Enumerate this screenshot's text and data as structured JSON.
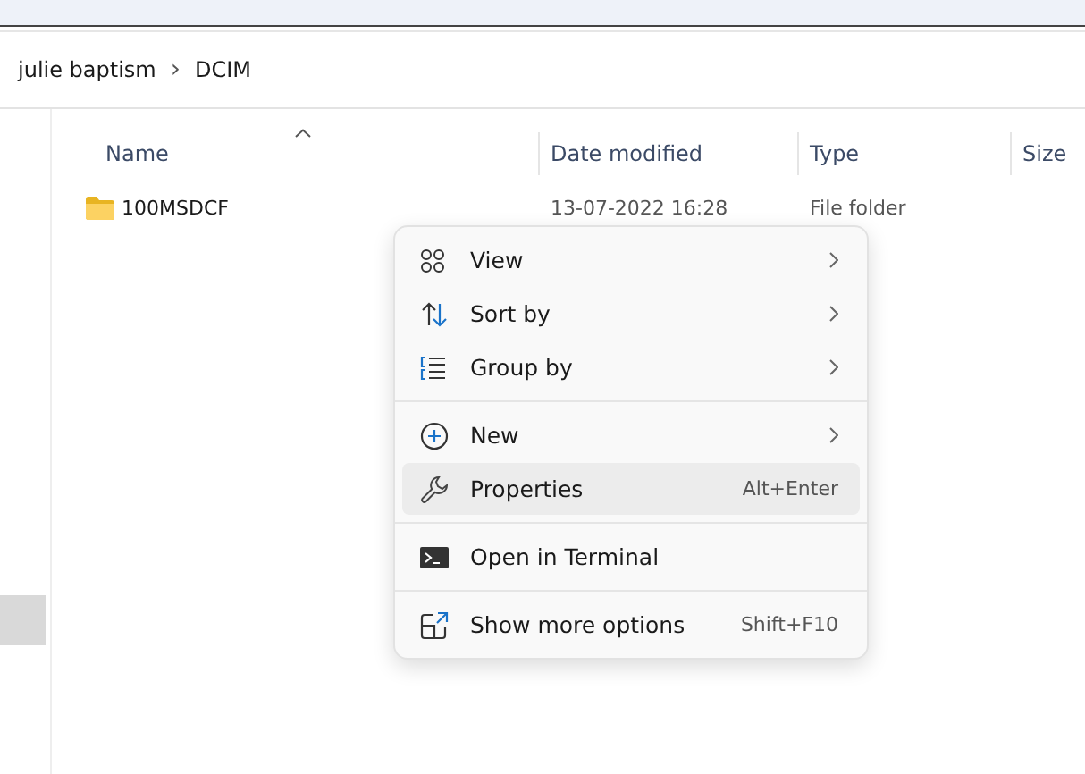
{
  "breadcrumb": [
    {
      "label": "julie baptism"
    },
    {
      "label": "DCIM"
    }
  ],
  "separator": "›",
  "columns": [
    {
      "label": "Name",
      "sorted": true
    },
    {
      "label": "Date modified",
      "sorted": false
    },
    {
      "label": "Type",
      "sorted": false
    },
    {
      "label": "Size",
      "sorted": false
    }
  ],
  "rows": [
    {
      "name": "100MSDCF",
      "date": "13-07-2022 16:28",
      "type": "File folder",
      "selected": false
    }
  ],
  "context_menu": [
    {
      "kind": "view",
      "label": "View",
      "submenu": true,
      "selected": false
    },
    {
      "kind": "sort",
      "label": "Sort by",
      "submenu": true,
      "selected": false
    },
    {
      "kind": "group",
      "label": "Group by",
      "submenu": true,
      "selected": false
    },
    {
      "kind": "separator"
    },
    {
      "kind": "new",
      "label": "New",
      "submenu": true,
      "selected": false
    },
    {
      "kind": "properties",
      "label": "Properties",
      "shortcut": "Alt+Enter",
      "submenu": false,
      "selected": true
    },
    {
      "kind": "separator"
    },
    {
      "kind": "terminal",
      "label": "Open in Terminal",
      "submenu": false,
      "selected": false
    },
    {
      "kind": "separator"
    },
    {
      "kind": "more",
      "label": "Show more options",
      "shortcut": "Shift+F10",
      "submenu": false,
      "selected": false
    }
  ]
}
